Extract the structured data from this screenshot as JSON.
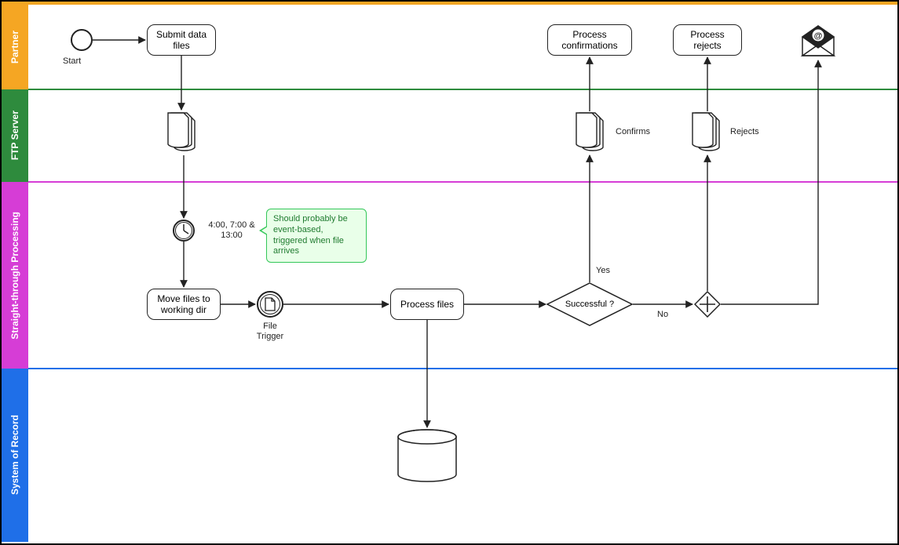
{
  "lanes": {
    "partner": "Partner",
    "ftp": "FTP Server",
    "stp": "Straight-through Processing",
    "sor": "System of Record"
  },
  "nodes": {
    "start_label": "Start",
    "submit_data": "Submit data files",
    "process_confirmations": "Process confirmations",
    "process_rejects": "Process rejects",
    "confirms_label": "Confirms",
    "rejects_label": "Rejects",
    "timer_label": "4:00, 7:00 & 13:00",
    "move_files": "Move files to working dir",
    "file_trigger_label": "File Trigger",
    "process_files": "Process files",
    "decision_text": "Successful ?",
    "decision_yes": "Yes",
    "decision_no": "No"
  },
  "callout": "Should probably be event-based, triggered when file arrives",
  "colors": {
    "partner": "#f5a623",
    "ftp": "#2e8b3d",
    "stp": "#d63dd6",
    "sor": "#1f6fe8",
    "callout_border": "#34c759",
    "callout_fill": "#e9ffe9"
  }
}
